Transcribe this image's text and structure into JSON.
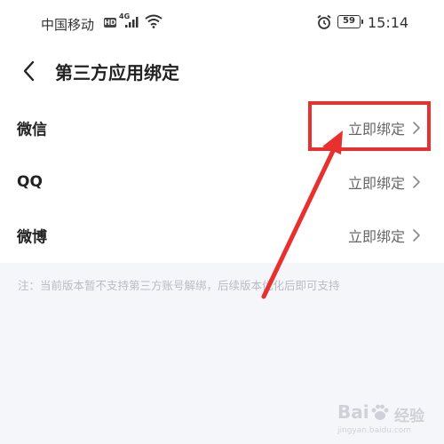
{
  "status_bar": {
    "carrier": "中国移动",
    "hd": "HD",
    "network": "4G",
    "battery": "59",
    "time": "15:14"
  },
  "header": {
    "title": "第三方应用绑定"
  },
  "bindings": [
    {
      "name": "微信",
      "action": "立即绑定"
    },
    {
      "name": "QQ",
      "action": "立即绑定"
    },
    {
      "name": "微博",
      "action": "立即绑定"
    }
  ],
  "note": "注：当前版本暂不支持第三方账号解绑，后续版本优化后即可支持",
  "watermark": {
    "brand": "Bai",
    "suffix": "经验",
    "url": "jingyan.baidu.com"
  },
  "colors": {
    "annotation": "#e8312f",
    "background": "#f5f6fa",
    "note_text": "#b8bcc5"
  }
}
